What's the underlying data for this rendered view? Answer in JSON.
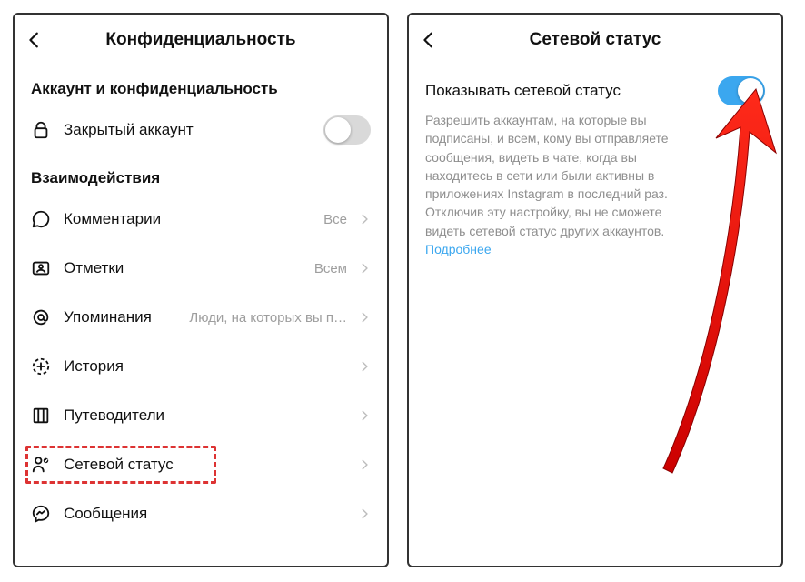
{
  "left": {
    "title": "Конфиденциальность",
    "section_account": "Аккаунт и конфиденциальность",
    "private_account": "Закрытый аккаунт",
    "private_account_on": false,
    "section_interact": "Взаимодействия",
    "rows": {
      "comments": {
        "label": "Комментарии",
        "value": "Все"
      },
      "tags": {
        "label": "Отметки",
        "value": "Всем"
      },
      "mentions": {
        "label": "Упоминания",
        "value": "Люди, на которых вы п…"
      },
      "story": {
        "label": "История",
        "value": ""
      },
      "guides": {
        "label": "Путеводители",
        "value": ""
      },
      "activity": {
        "label": "Сетевой статус",
        "value": ""
      },
      "messages": {
        "label": "Сообщения",
        "value": ""
      }
    }
  },
  "right": {
    "title": "Сетевой статус",
    "toggle_label": "Показывать сетевой статус",
    "toggle_on": true,
    "desc": "Разрешить аккаунтам, на которые вы подписаны, и всем, кому вы отправляете сообщения, видеть в чате, когда вы находитесь в сети или были активны в приложениях Instagram в последний раз. Отключив эту настройку, вы не сможете видеть сетевой статус других аккаунтов.",
    "link": "Подробнее"
  },
  "colors": {
    "accent": "#3ba7ef",
    "highlight": "#d33",
    "arrow": "#e30613"
  }
}
